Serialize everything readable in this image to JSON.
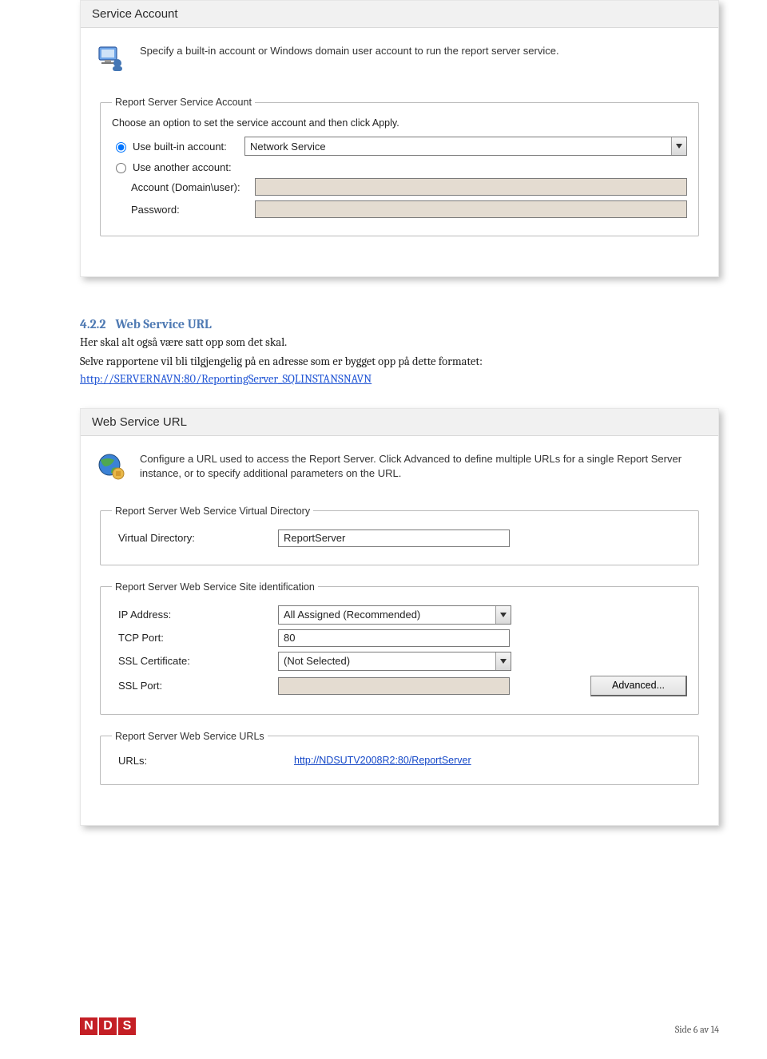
{
  "panel1": {
    "title": "Service Account",
    "intro": "Specify a built-in account or Windows domain user account to run the report server service.",
    "group_legend": "Report Server Service Account",
    "group_desc": "Choose an option to set the service account and then click Apply.",
    "radio1": "Use built-in account:",
    "builtin_value": "Network Service",
    "radio2": "Use another account:",
    "account_label": "Account (Domain\\user):",
    "password_label": "Password:"
  },
  "doc": {
    "section_num": "4.2.2",
    "section_title": "Web Service URL",
    "para1": "Her skal alt også være satt opp som det skal.",
    "para2": "Selve rapportene vil bli tilgjengelig på en adresse som er bygget opp på dette formatet:",
    "link": "http://SERVERNAVN:80/ReportingServer_SQLINSTANSNAVN"
  },
  "panel2": {
    "title": "Web Service URL",
    "intro": "Configure a URL used to access the Report Server. Click Advanced to define multiple URLs for a single Report Server instance, or to specify additional parameters on the URL.",
    "group1_legend": "Report Server Web Service Virtual Directory",
    "vdir_label": "Virtual Directory:",
    "vdir_value": "ReportServer",
    "group2_legend": "Report Server Web Service Site identification",
    "ip_label": "IP Address:",
    "ip_value": "All Assigned (Recommended)",
    "tcp_label": "TCP Port:",
    "tcp_value": "80",
    "sslcert_label": "SSL Certificate:",
    "sslcert_value": "(Not Selected)",
    "sslport_label": "SSL Port:",
    "advanced": "Advanced...",
    "group3_legend": "Report Server Web Service URLs",
    "urls_label": "URLs:",
    "urls_value": "http://NDSUTV2008R2:80/ReportServer"
  },
  "footer": {
    "logo": [
      "N",
      "D",
      "S"
    ],
    "page": "Side 6 av 14"
  }
}
